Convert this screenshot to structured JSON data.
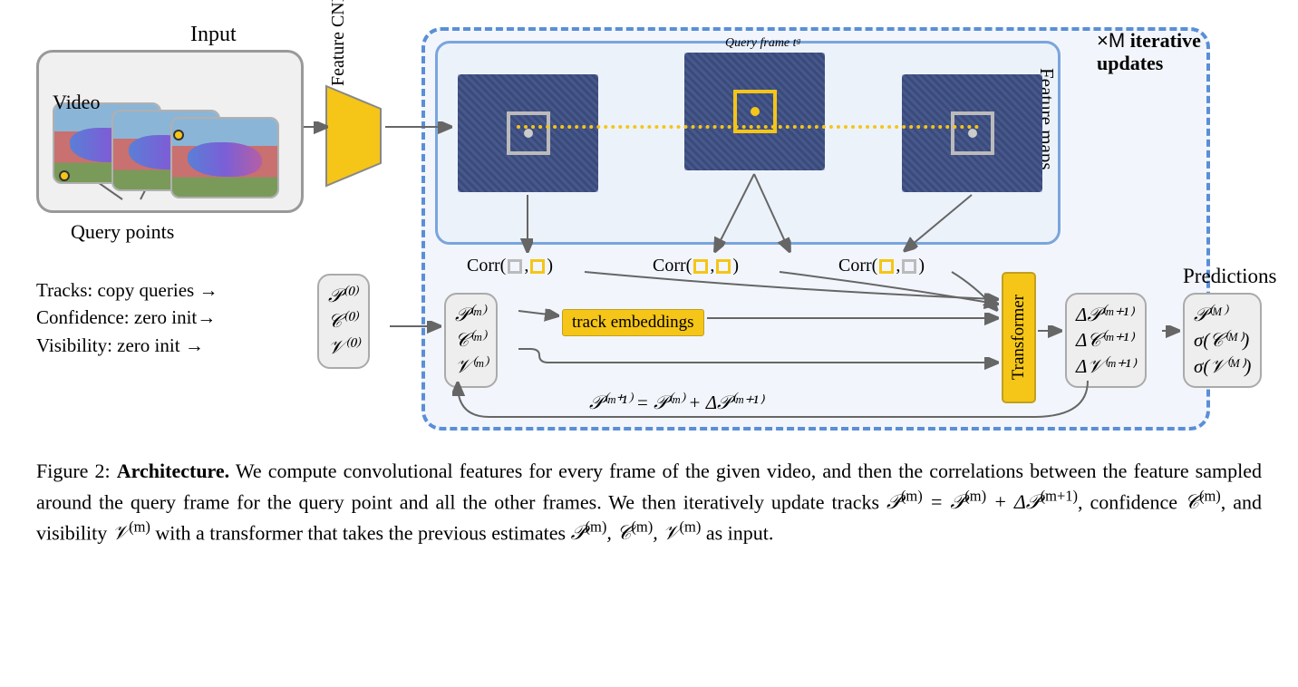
{
  "figure": {
    "number": "Figure 2:",
    "title": "Architecture.",
    "caption_body": "We compute convolutional features for every frame of the given video, and then the correlations between the feature sampled around the query frame for the query point and all the other frames. We then iteratively update tracks 𝒫(m) = 𝒫(m) + Δ𝒫(m+1), confidence 𝒞(m), and visibility 𝒱(m) with a transformer that takes the previous estimates 𝒫(m), 𝒞(m), 𝒱(m) as input."
  },
  "labels": {
    "input": "Input",
    "video": "Video",
    "query_points": "Query points",
    "feature_cnn": "Feature CNN",
    "query_frame": "Query frame tᵍ",
    "feature_maps": "Feature maps",
    "iterative": "×M iterative updates",
    "track_embeddings": "track embeddings",
    "transformer": "Transformer",
    "predictions": "Predictions",
    "corr": "Corr"
  },
  "init": {
    "tracks": "Tracks: copy queries",
    "confidence": "Confidence: zero init",
    "visibility": "Visibility: zero init"
  },
  "state0": {
    "p": "𝒫⁽⁰⁾",
    "c": "𝒞⁽⁰⁾",
    "v": "𝒱⁽⁰⁾"
  },
  "state_m": {
    "p": "𝒫⁽ᵐ⁾",
    "c": "𝒞⁽ᵐ⁾",
    "v": "𝒱⁽ᵐ⁾"
  },
  "delta": {
    "p": "Δ𝒫⁽ᵐ⁺¹⁾",
    "c": "Δ𝒞⁽ᵐ⁺¹⁾",
    "v": "Δ𝒱⁽ᵐ⁺¹⁾"
  },
  "pred": {
    "p": "𝒫⁽ᴹ⁾",
    "c": "σ(𝒞⁽ᴹ⁾)",
    "v": "σ(𝒱⁽ᴹ⁾)"
  },
  "update_eq": "𝒫⁽ᵐ⁺¹⁾ = 𝒫⁽ᵐ⁾ + Δ𝒫⁽ᵐ⁺¹⁾"
}
